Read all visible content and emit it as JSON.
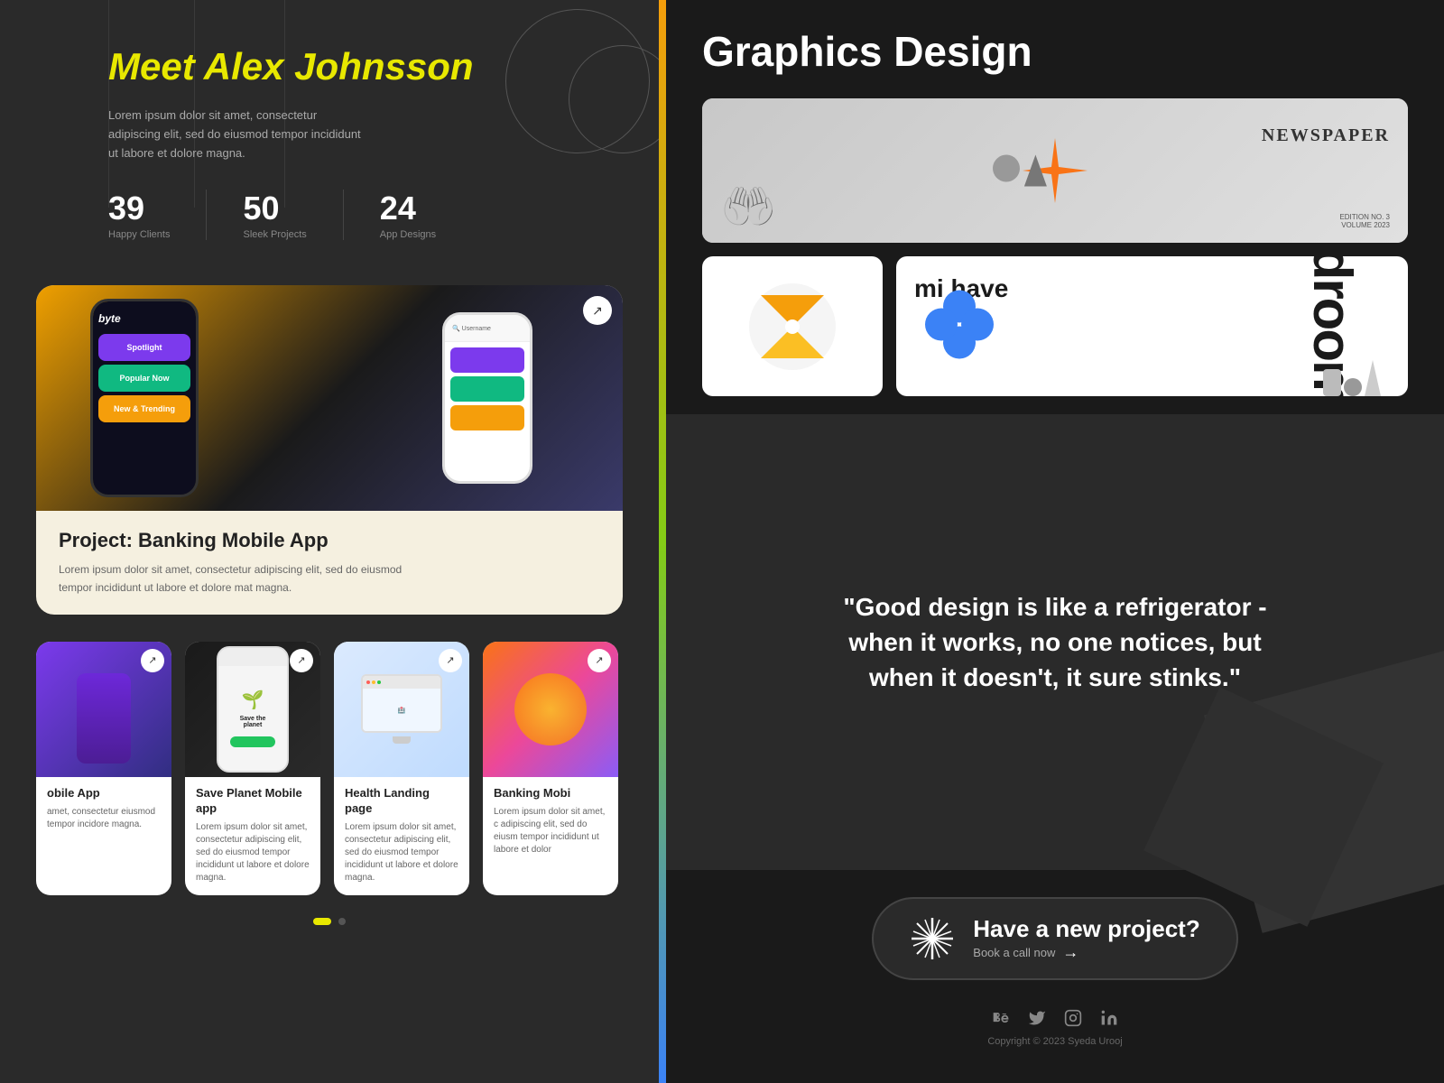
{
  "left_panel": {
    "hero": {
      "name": "Meet Alex Johnsson",
      "description": "Lorem ipsum dolor sit amet, consectetur adipiscing elit, sed do eiusmod tempor incididunt ut labore et dolore magna.",
      "stats": [
        {
          "number": "39",
          "label": "Happy Clients"
        },
        {
          "number": "50",
          "label": "Sleek Projects"
        },
        {
          "number": "24",
          "label": "App Designs"
        }
      ]
    },
    "featured_project": {
      "title": "Project: Banking Mobile App",
      "description": "Lorem ipsum dolor sit amet, consectetur adipiscing elit, sed do eiusmod tempor incididunt ut labore et dolore mat magna.",
      "link_icon": "↗"
    },
    "projects": [
      {
        "title": "obile App",
        "description": "amet, consectetur eiusmod tempor incidore magna.",
        "image_type": "purple"
      },
      {
        "title": "Save Planet Mobile app",
        "description": "Lorem ipsum dolor sit amet, consectetur adipiscing elit, sed do eiusmod tempor incididunt ut labore et dolore magna.",
        "image_type": "green"
      },
      {
        "title": "Health Landing page",
        "description": "Lorem ipsum dolor sit amet, consectetur adipiscing elit, sed do eiusmod tempor incididunt ut labore et dolore magna.",
        "image_type": "blue"
      },
      {
        "title": "Banking Mobi",
        "description": "Lorem ipsum dolor sit amet, c adipiscing elit, sed do eiusm tempor incididunt ut labore et dolor",
        "image_type": "gradient"
      }
    ],
    "dots": [
      "active",
      "inactive"
    ]
  },
  "right_panel": {
    "title": "Graphics Design",
    "graphics": [
      {
        "type": "newspaper",
        "label": "Newspaper Design"
      },
      {
        "type": "yellow-logo",
        "label": "Yellow Logo"
      },
      {
        "type": "droom",
        "label": "Droom Branding"
      }
    ],
    "quote": "\"Good design is like a refrigerator - when it works, no one notices, but when it doesn't, it sure stinks.\"",
    "cta": {
      "main_text": "Have a new project?",
      "sub_text": "Book a call now",
      "arrow": "→"
    },
    "footer": {
      "social_icons": [
        "behance",
        "twitter",
        "instagram",
        "linkedin"
      ],
      "copyright": "Copyright © 2023 Syeda Urooj"
    }
  }
}
